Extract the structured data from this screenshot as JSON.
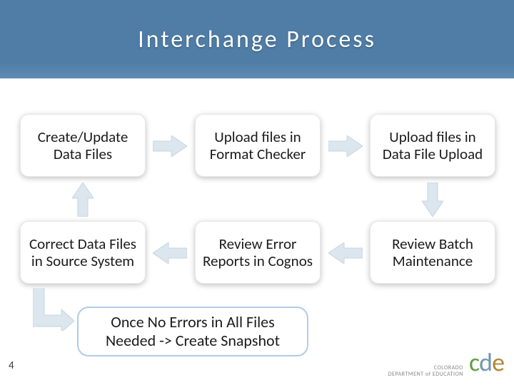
{
  "title": "Interchange Process",
  "page_number": "4",
  "boxes": {
    "b1": "Create/Update Data Files",
    "b2": "Upload files in Format Checker",
    "b3": "Upload files in Data File Upload",
    "b4": "Correct Data Files in Source System",
    "b5": "Review Error Reports in Cognos",
    "b6": "Review Batch Maintenance",
    "final": "Once No Errors in All Files Needed -> Create Snapshot"
  },
  "footer": {
    "org_line1": "COLORADO",
    "org_line2": "DEPARTMENT of EDUCATION",
    "logo": "cde"
  },
  "arrow_fill": "#dbe6ee"
}
